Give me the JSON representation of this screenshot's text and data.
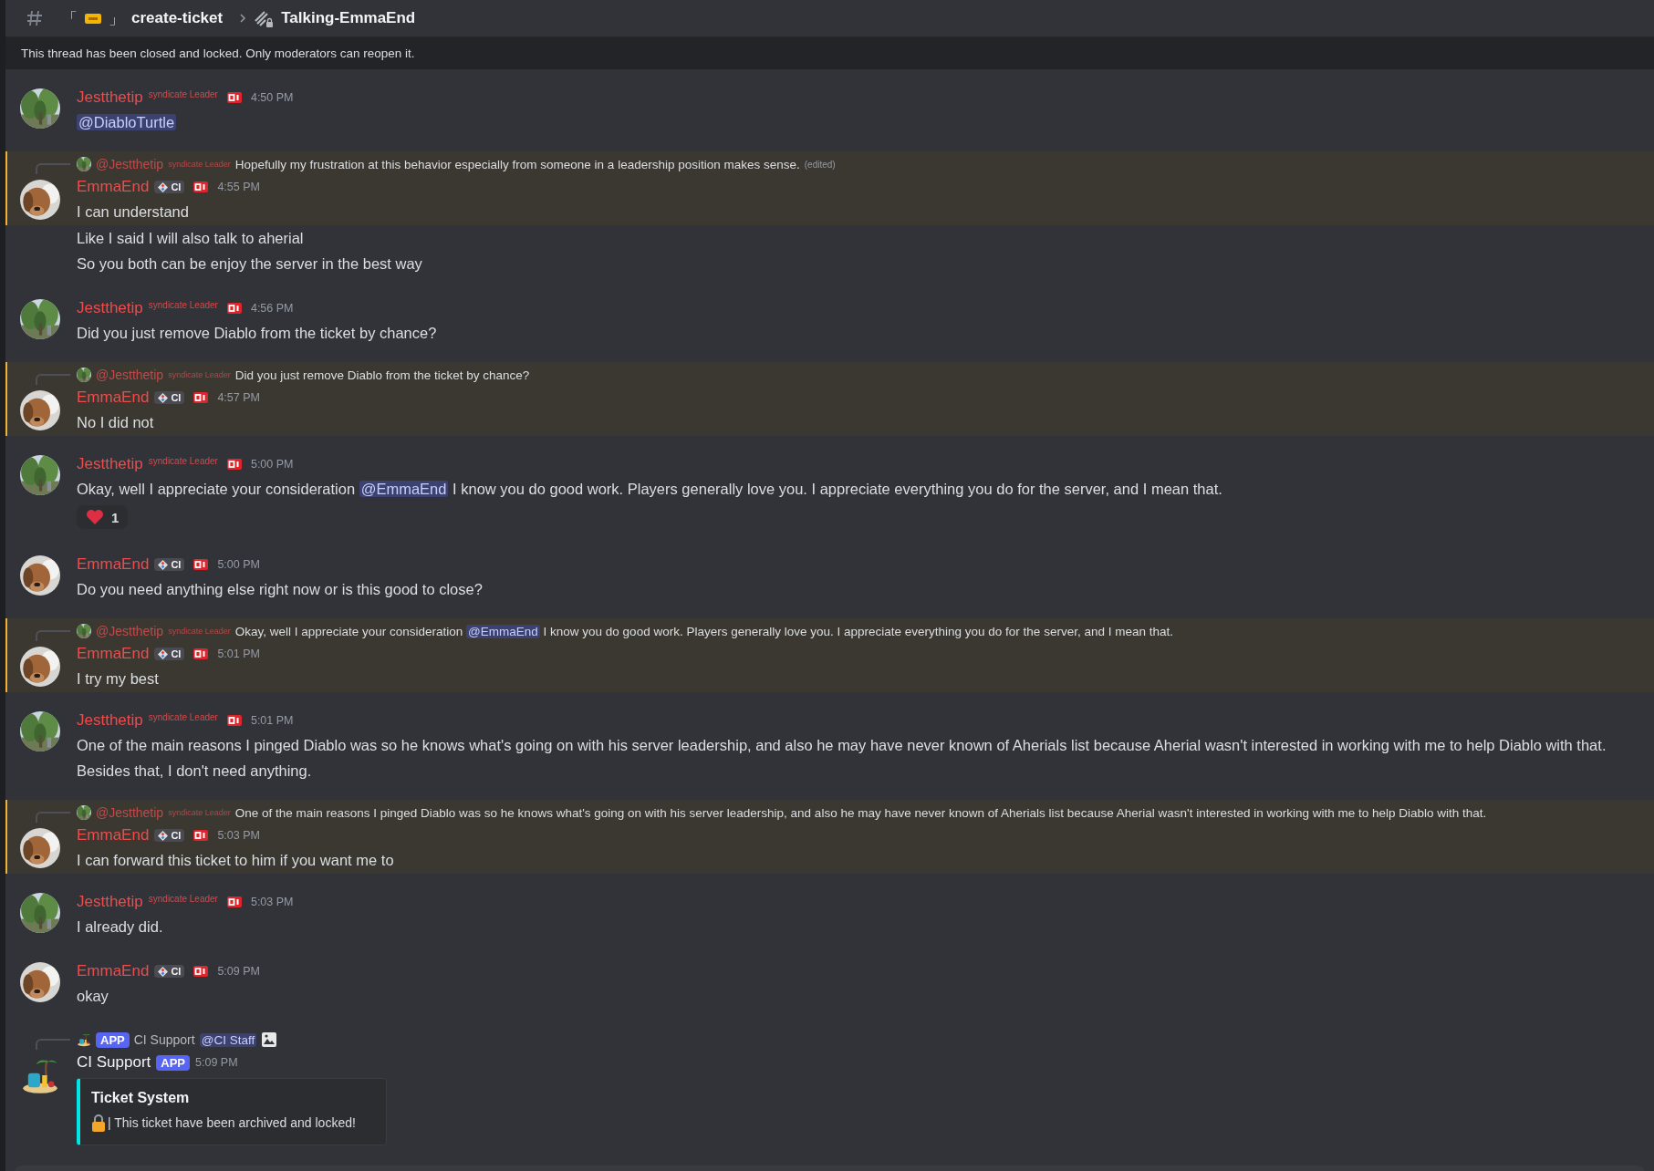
{
  "header": {
    "bracket_open": "「",
    "bracket_close": "」",
    "channel": "create-ticket",
    "thread": "Talking-EmmaEnd"
  },
  "banner": "This thread has been closed and locked. Only moderators can reopen it.",
  "messages": [
    {
      "kind": "message",
      "author": "Jestthetip",
      "tag": "syndicate Leader",
      "time": "4:50 PM",
      "highlighted": false,
      "lines": [
        [
          {
            "kind": "mention",
            "text": "@DiabloTurtle"
          }
        ]
      ]
    },
    {
      "kind": "message",
      "author": "EmmaEnd",
      "role": "CI",
      "time": "4:55 PM",
      "highlighted": true,
      "reply": {
        "kind": "user",
        "author": "@Jestthetip",
        "tag": "syndicate Leader",
        "text": "Hopefully my frustration at this behavior especially from someone in a leadership position makes sense.",
        "edited": "(edited)"
      },
      "lines": [
        "I can understand"
      ]
    },
    {
      "kind": "followup",
      "highlighted": false,
      "lines": [
        "Like I said I will also talk to aherial",
        "So you both can be enjoy the server in the best way"
      ]
    },
    {
      "kind": "message",
      "author": "Jestthetip",
      "tag": "syndicate Leader",
      "time": "4:56 PM",
      "highlighted": false,
      "lines": [
        "Did you just remove Diablo from the ticket by chance?"
      ]
    },
    {
      "kind": "message",
      "author": "EmmaEnd",
      "role": "CI",
      "time": "4:57 PM",
      "highlighted": true,
      "reply": {
        "kind": "user",
        "author": "@Jestthetip",
        "tag": "syndicate Leader",
        "text": "Did you just remove Diablo from the ticket by chance?"
      },
      "lines": [
        "No I did not"
      ]
    },
    {
      "kind": "message",
      "author": "Jestthetip",
      "tag": "syndicate Leader",
      "time": "5:00 PM",
      "highlighted": false,
      "lines": [
        [
          {
            "kind": "text",
            "text": "Okay, well I appreciate your consideration "
          },
          {
            "kind": "mention",
            "text": "@EmmaEnd"
          },
          {
            "kind": "text",
            "text": " I know you do good work. Players generally love you. I appreciate everything you do for the server, and I mean that."
          }
        ]
      ],
      "reaction": {
        "count": "1"
      }
    },
    {
      "kind": "message",
      "author": "EmmaEnd",
      "role": "CI",
      "time": "5:00 PM",
      "highlighted": false,
      "lines": [
        "Do you need anything else right now or is this good to close?"
      ]
    },
    {
      "kind": "message",
      "author": "EmmaEnd",
      "role": "CI",
      "time": "5:01 PM",
      "highlighted": true,
      "reply": {
        "kind": "user",
        "author": "@Jestthetip",
        "tag": "syndicate Leader",
        "text": [
          {
            "kind": "text",
            "text": "Okay, well I appreciate your consideration "
          },
          {
            "kind": "mention",
            "text": "@EmmaEnd"
          },
          {
            "kind": "text",
            "text": " I know you do good work. Players generally love you. I appreciate everything you do for the server, and I mean that."
          }
        ]
      },
      "lines": [
        "I try my best"
      ]
    },
    {
      "kind": "message",
      "author": "Jestthetip",
      "tag": "syndicate Leader",
      "time": "5:01 PM",
      "highlighted": false,
      "lines": [
        "One of the main reasons I pinged Diablo was so he knows what's going on with his server leadership, and also he may have never known of Aherials list because Aherial wasn't interested in working with me to help Diablo with that.",
        "Besides that, I don't need anything."
      ]
    },
    {
      "kind": "message",
      "author": "EmmaEnd",
      "role": "CI",
      "time": "5:03 PM",
      "highlighted": true,
      "reply": {
        "kind": "user",
        "author": "@Jestthetip",
        "tag": "syndicate Leader",
        "text": "One of the main reasons I pinged Diablo was so he knows what's going on with his server leadership, and also he may have never known of Aherials list because Aherial wasn't interested in working with me to help Diablo with that."
      },
      "lines": [
        "I can forward this ticket to him if you want me to"
      ]
    },
    {
      "kind": "message",
      "author": "Jestthetip",
      "tag": "syndicate Leader",
      "time": "5:03 PM",
      "highlighted": false,
      "lines": [
        "I already did."
      ]
    },
    {
      "kind": "message",
      "author": "EmmaEnd",
      "role": "CI",
      "time": "5:09 PM",
      "highlighted": false,
      "lines": [
        "okay"
      ]
    },
    {
      "kind": "message",
      "author": "CI Support",
      "app": "APP",
      "time": "5:09 PM",
      "highlighted": false,
      "reply": {
        "kind": "app",
        "badge": "APP",
        "author": "CI Support",
        "mention": "@CI Staff"
      },
      "embed": {
        "title": "Ticket System",
        "text": "| This ticket have been archived and locked!"
      }
    }
  ]
}
